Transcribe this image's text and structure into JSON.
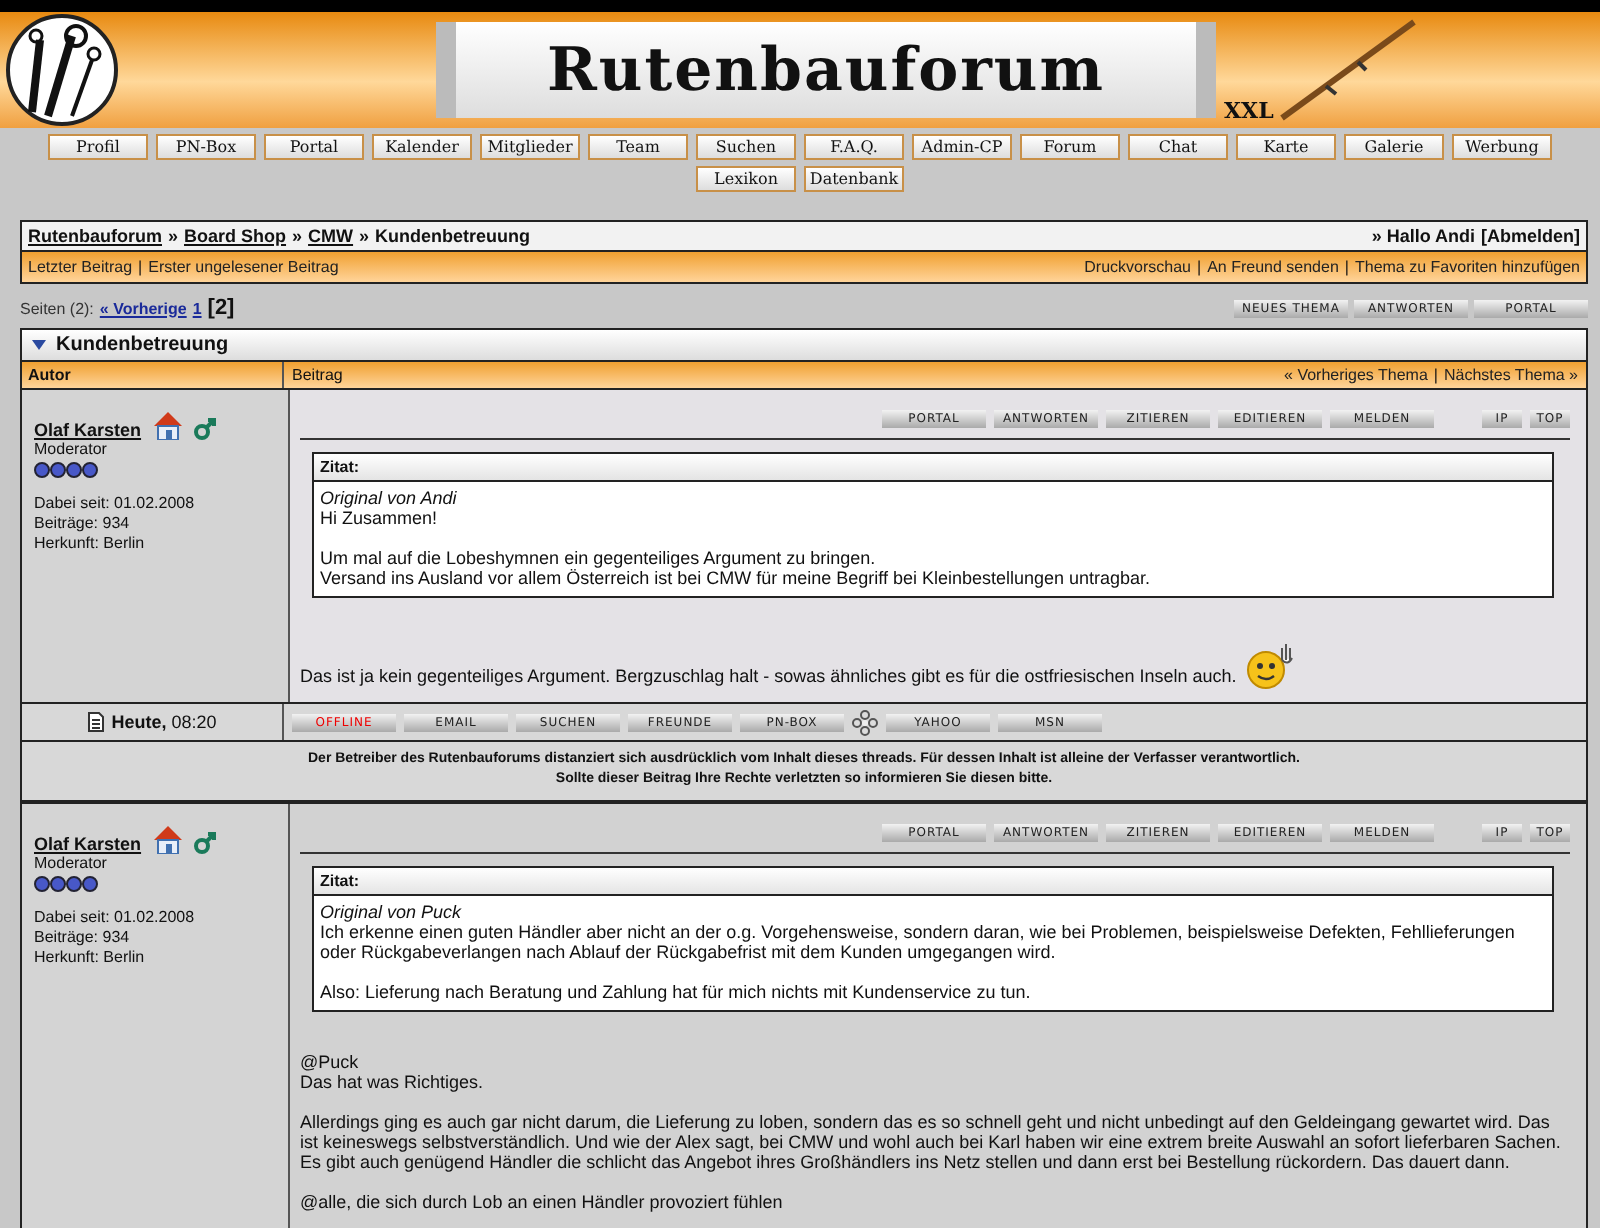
{
  "header": {
    "title": "Rutenbauforum",
    "subtitle": "XXL"
  },
  "nav": [
    "Profil",
    "PN-Box",
    "Portal",
    "Kalender",
    "Mitglieder",
    "Team",
    "Suchen",
    "F.A.Q.",
    "Admin-CP",
    "Forum",
    "Chat",
    "Karte",
    "Galerie",
    "Werbung",
    "Lexikon",
    "Datenbank"
  ],
  "breadcrumb": {
    "items": [
      "Rutenbauforum",
      "Board Shop",
      "CMW"
    ],
    "separator": "»",
    "current": "Kundenbetreuung",
    "greeting": "» Hallo Andi",
    "logout": "[Abmelden]"
  },
  "separator": "|",
  "actions_left": [
    "Letzter Beitrag",
    "Erster ungelesener Beitrag"
  ],
  "actions_right": [
    "Druckvorschau",
    "An Freund senden",
    "Thema zu Favoriten hinzufügen"
  ],
  "pages": {
    "label": "Seiten (2):",
    "prev": "« Vorherige",
    "items": [
      {
        "label": "1",
        "selected": false
      },
      {
        "label": "[2]",
        "selected": true
      }
    ]
  },
  "top_buttons": [
    "NEUES THEMA",
    "ANTWORTEN",
    "PORTAL"
  ],
  "thread": {
    "title": "Kundenbetreuung",
    "col_author": "Autor",
    "col_post": "Beitrag",
    "prev_thread": "« Vorheriges Thema",
    "next_thread": "Nächstes Thema »"
  },
  "posts": [
    {
      "author": "Olaf Karsten",
      "rank": "Moderator",
      "stars": 4,
      "joined": "Dabei seit: 01.02.2008",
      "count": "Beiträge: 934",
      "origin": "Herkunft: Berlin",
      "buttons": [
        "PORTAL",
        "ANTWORTEN",
        "ZITIEREN",
        "EDITIEREN",
        "MELDEN"
      ],
      "side_buttons": [
        "IP",
        "TOP"
      ],
      "quote": {
        "title": "Zitat:",
        "source": "Original von Andi",
        "paragraphs": [
          "Hi Zusammen!",
          "Um mal auf die Lobeshymnen ein gegenteiliges Argument zu bringen.\nVersand ins Ausland vor allem Österreich ist bei CMW für meine Begriff bei Kleinbestellungen untragbar."
        ]
      },
      "body": [
        "Das ist ja kein gegenteiliges Argument. Bergzuschlag halt - sowas ähnliches gibt es für die ostfriesischen Inseln auch."
      ],
      "smiley": true,
      "footer": {
        "day": "Heute,",
        "time": "08:20",
        "contacts": [
          {
            "label": "OFFLINE",
            "kind": "status"
          },
          {
            "label": "EMAIL",
            "kind": "button"
          },
          {
            "label": "SUCHEN",
            "kind": "button"
          },
          {
            "label": "FREUNDE",
            "kind": "button"
          },
          {
            "label": "PN-BOX",
            "kind": "button"
          },
          {
            "kind": "icq"
          },
          {
            "label": "YAHOO",
            "kind": "button"
          },
          {
            "label": "MSN",
            "kind": "button"
          }
        ]
      },
      "disclaimer": "Der Betreiber des Rutenbauforums distanziert sich ausdrücklich vom Inhalt dieses threads. Für dessen Inhalt ist alleine der Verfasser verantwortlich.\nSollte dieser Beitrag Ihre Rechte verletzten so informieren Sie diesen bitte."
    },
    {
      "author": "Olaf Karsten",
      "rank": "Moderator",
      "stars": 4,
      "joined": "Dabei seit: 01.02.2008",
      "count": "Beiträge: 934",
      "origin": "Herkunft: Berlin",
      "buttons": [
        "PORTAL",
        "ANTWORTEN",
        "ZITIEREN",
        "EDITIEREN",
        "MELDEN"
      ],
      "side_buttons": [
        "IP",
        "TOP"
      ],
      "quote": {
        "title": "Zitat:",
        "source": "Original von Puck",
        "paragraphs": [
          "Ich erkenne einen guten Händler aber nicht an der o.g. Vorgehensweise, sondern daran, wie bei Problemen, beispielsweise Defekten, Fehllieferungen oder Rückgabeverlangen nach Ablauf der Rückgabefrist mit dem Kunden umgegangen wird.",
          "Also: Lieferung nach Beratung und Zahlung hat für mich nichts mit Kundenservice zu tun."
        ]
      },
      "body": [
        "@Puck\nDas hat was Richtiges.",
        "Allerdings ging es auch gar nicht darum, die Lieferung zu loben, sondern das es so schnell geht und nicht unbedingt auf den Geldeingang gewartet wird. Das ist keineswegs selbstverständlich. Und wie der Alex sagt, bei CMW und wohl auch bei Karl haben wir eine extrem breite Auswahl an sofort lieferbaren Sachen. Es gibt auch genügend Händler die schlicht das Angebot ihres Großhändlers ins Netz stellen und dann erst bei Bestellung rückordern. Das dauert dann.",
        "@alle, die sich durch Lob an einen Händler provoziert fühlen"
      ],
      "smiley": false
    }
  ]
}
